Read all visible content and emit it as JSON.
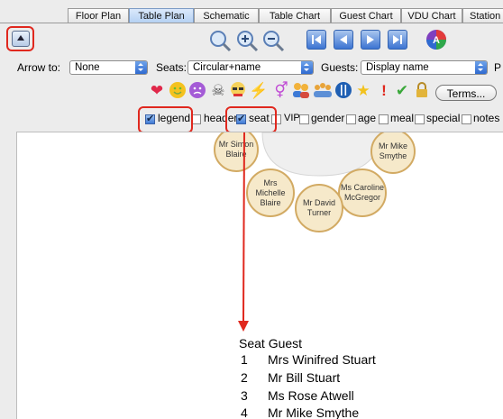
{
  "tabs": [
    "Floor Plan",
    "Table Plan",
    "Schematic",
    "Table Chart",
    "Guest Chart",
    "VDU Chart",
    "Station"
  ],
  "active_tab": "Table Plan",
  "toolbar": {
    "arrow_to_label": "Arrow to:",
    "arrow_to_value": "None",
    "seats_label": "Seats:",
    "seats_value": "Circular+name",
    "guests_label": "Guests:",
    "guests_value": "Display name",
    "cutoff_label": "P",
    "terms_label": "Terms..."
  },
  "icons": [
    "zoom-fit-icon",
    "zoom-in-icon",
    "zoom-out-icon",
    "first-icon",
    "previous-icon",
    "next-icon",
    "last-icon",
    "color-wheel-icon",
    "heart-icon",
    "smile-icon",
    "frown-icon",
    "skull-icon",
    "glasses-icon",
    "lightning-icon",
    "gender-icon",
    "people-icon",
    "group-icon",
    "cutlery-icon",
    "star-icon",
    "exclamation-icon",
    "check-icon",
    "lock-icon"
  ],
  "options": [
    {
      "label": "legend",
      "checked": true
    },
    {
      "label": "header",
      "checked": false
    },
    {
      "label": "seat",
      "checked": true
    },
    {
      "label": "VIP",
      "checked": false
    },
    {
      "label": "gender",
      "checked": false
    },
    {
      "label": "age",
      "checked": false
    },
    {
      "label": "meal",
      "checked": false
    },
    {
      "label": "special",
      "checked": false
    },
    {
      "label": "notes",
      "checked": false
    }
  ],
  "seats": [
    {
      "name": "Mr Simon Blaire"
    },
    {
      "name": "Mr Mike Smythe"
    },
    {
      "name": "Mrs Michelle Blaire"
    },
    {
      "name": "Ms Caroline McGregor"
    },
    {
      "name": "Mr David Turner"
    }
  ],
  "legend": {
    "header_seat": "Seat",
    "header_guest": "Guest",
    "rows": [
      {
        "seat": "1",
        "guest": "Mrs Winifred Stuart"
      },
      {
        "seat": "2",
        "guest": "Mr Bill Stuart"
      },
      {
        "seat": "3",
        "guest": "Ms Rose Atwell"
      },
      {
        "seat": "4",
        "guest": "Mr Mike Smythe"
      }
    ]
  },
  "colors": {
    "highlight": "#e0281e",
    "seat_fill": "#f6e9ca",
    "seat_border": "#d2aa63",
    "tab_active": "#b5d1f3"
  }
}
